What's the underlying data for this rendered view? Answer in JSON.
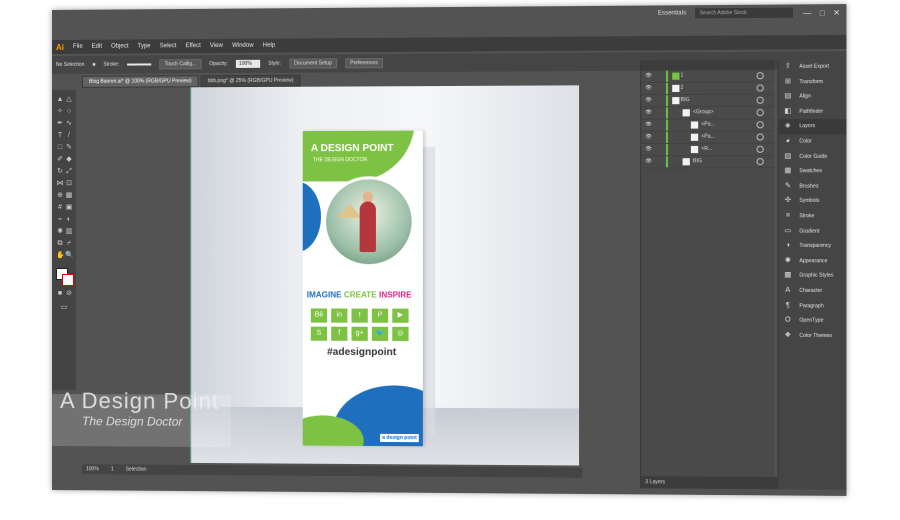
{
  "app": {
    "logo": "Ai"
  },
  "menu": [
    "File",
    "Edit",
    "Object",
    "Type",
    "Select",
    "Effect",
    "View",
    "Window",
    "Help"
  ],
  "topright": {
    "workspace": "Essentials",
    "search_placeholder": "Search Adobe Stock"
  },
  "control": {
    "selection_label": "No Selection",
    "stroke_label": "Stroke:",
    "brush": "Touch Callig...",
    "opacity_label": "Opacity:",
    "opacity_value": "100%",
    "style_label": "Style:",
    "doc_setup": "Document Setup",
    "preferences": "Preferences"
  },
  "tabs": [
    {
      "label": "Blog Banner.ai* @ 100% (RGB/GPU Preview)"
    },
    {
      "label": "bbb.png* @ 25% (RGB/GPU Preview)"
    }
  ],
  "banner": {
    "title": "A DESIGN POINT",
    "subtitle": "THE DESIGN DOCTOR",
    "tagline_words": [
      {
        "text": "IMAGINE",
        "color": "#1f6fbf"
      },
      {
        "text": "CREATE",
        "color": "#7dc242"
      },
      {
        "text": "INSPIRE",
        "color": "#e0218a"
      }
    ],
    "hashtag": "#adesignpoint",
    "brand_small": "a design point"
  },
  "watermark": {
    "title": "A Design Point",
    "subtitle": "The Design Doctor"
  },
  "layers": {
    "rows": [
      {
        "name": "1",
        "indent": 0
      },
      {
        "name": "2",
        "indent": 0
      },
      {
        "name": "BIG",
        "indent": 0
      },
      {
        "name": "<Group>",
        "indent": 1
      },
      {
        "name": "<Pa...",
        "indent": 2
      },
      {
        "name": "<Pa...",
        "indent": 2
      },
      {
        "name": "<R...",
        "indent": 2
      },
      {
        "name": "BIG",
        "indent": 1
      }
    ],
    "footer": "3 Layers"
  },
  "panels": [
    {
      "label": "Asset Export",
      "icon": "asset-export-icon"
    },
    {
      "label": "Transform",
      "icon": "transform-icon"
    },
    {
      "label": "Align",
      "icon": "align-icon"
    },
    {
      "label": "Pathfinder",
      "icon": "pathfinder-icon"
    },
    {
      "label": "Layers",
      "icon": "layers-icon"
    },
    {
      "label": "Color",
      "icon": "color-icon"
    },
    {
      "label": "Color Guide",
      "icon": "color-guide-icon"
    },
    {
      "label": "Swatches",
      "icon": "swatches-icon"
    },
    {
      "label": "Brushes",
      "icon": "brushes-icon"
    },
    {
      "label": "Symbols",
      "icon": "symbols-icon"
    },
    {
      "label": "Stroke",
      "icon": "stroke-icon"
    },
    {
      "label": "Gradient",
      "icon": "gradient-icon"
    },
    {
      "label": "Transparency",
      "icon": "transparency-icon"
    },
    {
      "label": "Appearance",
      "icon": "appearance-icon"
    },
    {
      "label": "Graphic Styles",
      "icon": "graphic-styles-icon"
    },
    {
      "label": "Character",
      "icon": "character-icon"
    },
    {
      "label": "Paragraph",
      "icon": "paragraph-icon"
    },
    {
      "label": "OpenType",
      "icon": "opentype-icon"
    },
    {
      "label": "Color Themes",
      "icon": "color-themes-icon"
    }
  ],
  "status": {
    "zoom": "100%",
    "page": "1",
    "mode": "Selection"
  }
}
